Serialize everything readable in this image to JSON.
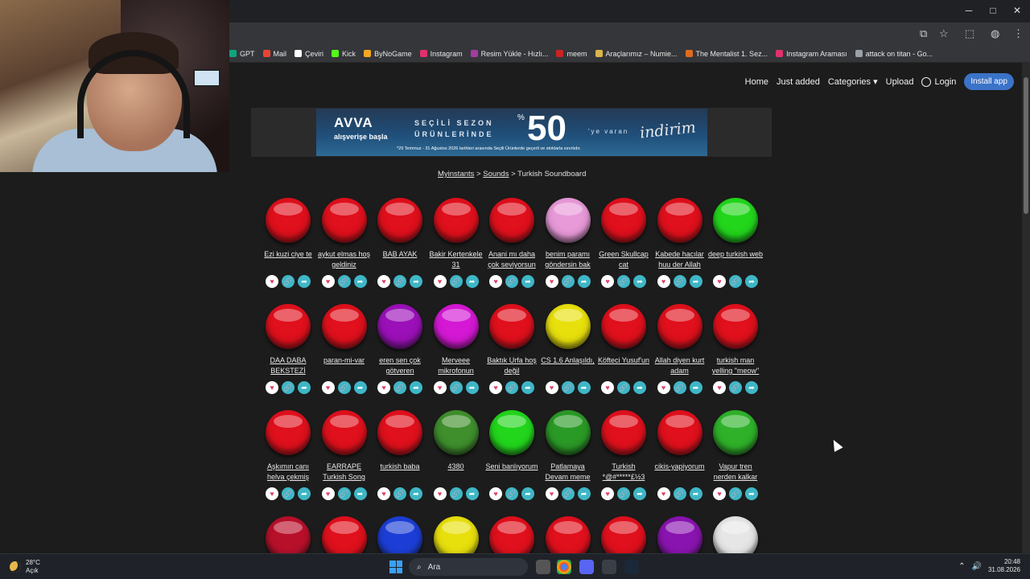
{
  "browser": {
    "window_controls": [
      "─",
      "□",
      "✕"
    ],
    "bookmarks": [
      {
        "label": "GPT",
        "color": "#10a37f"
      },
      {
        "label": "Mail",
        "color": "#ea4335"
      },
      {
        "label": "Çeviri",
        "color": "#ffffff"
      },
      {
        "label": "Kick",
        "color": "#53fc18"
      },
      {
        "label": "ByNoGame",
        "color": "#f5a623"
      },
      {
        "label": "Instagram",
        "color": "#e1306c"
      },
      {
        "label": "Resim Yükle - Hızlı...",
        "color": "#a33ca3"
      },
      {
        "label": "meem",
        "color": "#cc2222"
      },
      {
        "label": "Araçlarımız – Numie...",
        "color": "#d9b54a"
      },
      {
        "label": "The Mentalist 1. Sez...",
        "color": "#e06b1f"
      },
      {
        "label": "Instagram Araması",
        "color": "#e1306c"
      },
      {
        "label": "attack on titan - Go...",
        "color": "#9aa0a6"
      }
    ]
  },
  "nav": {
    "home": "Home",
    "just_added": "Just added",
    "categories": "Categories",
    "upload": "Upload",
    "login": "Login",
    "install": "Install app"
  },
  "ad": {
    "brand": "AVVA",
    "sub": "alışverişe başla",
    "line1": "SEÇİLİ SEZON",
    "line2": "ÜRÜNLERİNDE",
    "pct": "%",
    "big": "50",
    "varan": "'ye varan",
    "indirim": "indirim",
    "fine": "*29 Temmuz - 31 Ağustos 2026 tarihleri arasında Seçili Ürünlerde geçerli ve stoklarla sınırlıdır."
  },
  "breadcrumb": {
    "root": "Myinstants",
    "sep": ">",
    "sounds": "Sounds",
    "current": "Turkish Soundboard"
  },
  "sounds": [
    {
      "label": "Ezi kuzi ciye te",
      "color": "#e0101c"
    },
    {
      "label": "aykut elmas hoş geldiniz",
      "color": "#e0101c"
    },
    {
      "label": "BAB AYAK",
      "color": "#e0101c"
    },
    {
      "label": "Bakir Kertenkele 31",
      "color": "#e0101c"
    },
    {
      "label": "Anani mı daha çok seviyorsun",
      "color": "#e0101c"
    },
    {
      "label": "benim paramı göndersin bak",
      "color": "#e899d8"
    },
    {
      "label": "Green Skullcap cat",
      "color": "#e0101c"
    },
    {
      "label": "Kabede hacılar huu der Allah",
      "color": "#e0101c"
    },
    {
      "label": "deep turkish web",
      "color": "#22d61c"
    },
    {
      "label": "DAA DABA BEKSTEZİ",
      "color": "#e0101c"
    },
    {
      "label": "paran-mi-var",
      "color": "#e0101c"
    },
    {
      "label": "eren sen çok götveren",
      "color": "#9b10b8"
    },
    {
      "label": "Merveee mikrofonun",
      "color": "#d418d4"
    },
    {
      "label": "Baktık Urfa hoş değil",
      "color": "#e0101c"
    },
    {
      "label": "CS 1.6 Anlaşıldı,",
      "color": "#e8e00c"
    },
    {
      "label": "Köfteci Yusuf'un",
      "color": "#e0101c"
    },
    {
      "label": "Allah diyen kurt adam",
      "color": "#e0101c"
    },
    {
      "label": "turkish man yelling \"meow\"",
      "color": "#e0101c"
    },
    {
      "label": "Aşkımın canı helva çekmiş",
      "color": "#e0101c"
    },
    {
      "label": "EARRAPE Turkish Song",
      "color": "#e0101c"
    },
    {
      "label": "turkish baba",
      "color": "#e0101c"
    },
    {
      "label": "4380",
      "color": "#3f8f2c"
    },
    {
      "label": "Seni banlıyorum",
      "color": "#22d61c"
    },
    {
      "label": "Patlamaya Devam meme",
      "color": "#2a9a26"
    },
    {
      "label": "Turkish *@#*****£½3",
      "color": "#e0101c"
    },
    {
      "label": "cikis-yapiyorum",
      "color": "#e0101c"
    },
    {
      "label": "Vapur tren nerden kalkar",
      "color": "#2fb22a"
    },
    {
      "label": "",
      "color": "#b8102a"
    },
    {
      "label": "",
      "color": "#e0101c"
    },
    {
      "label": "",
      "color": "#1c3ed6"
    },
    {
      "label": "",
      "color": "#e8e00c"
    },
    {
      "label": "",
      "color": "#e0101c"
    },
    {
      "label": "",
      "color": "#e0101c"
    },
    {
      "label": "",
      "color": "#e0101c"
    },
    {
      "label": "",
      "color": "#8a14b0"
    },
    {
      "label": "",
      "color": "#e6e6e6"
    }
  ],
  "action_icons": {
    "heart": "♥",
    "link": "🔗",
    "share": "➦"
  },
  "taskbar": {
    "temp": "28°C",
    "condition": "Açık",
    "search": "Ara",
    "time": "20:48",
    "date": "31.08.2026"
  }
}
